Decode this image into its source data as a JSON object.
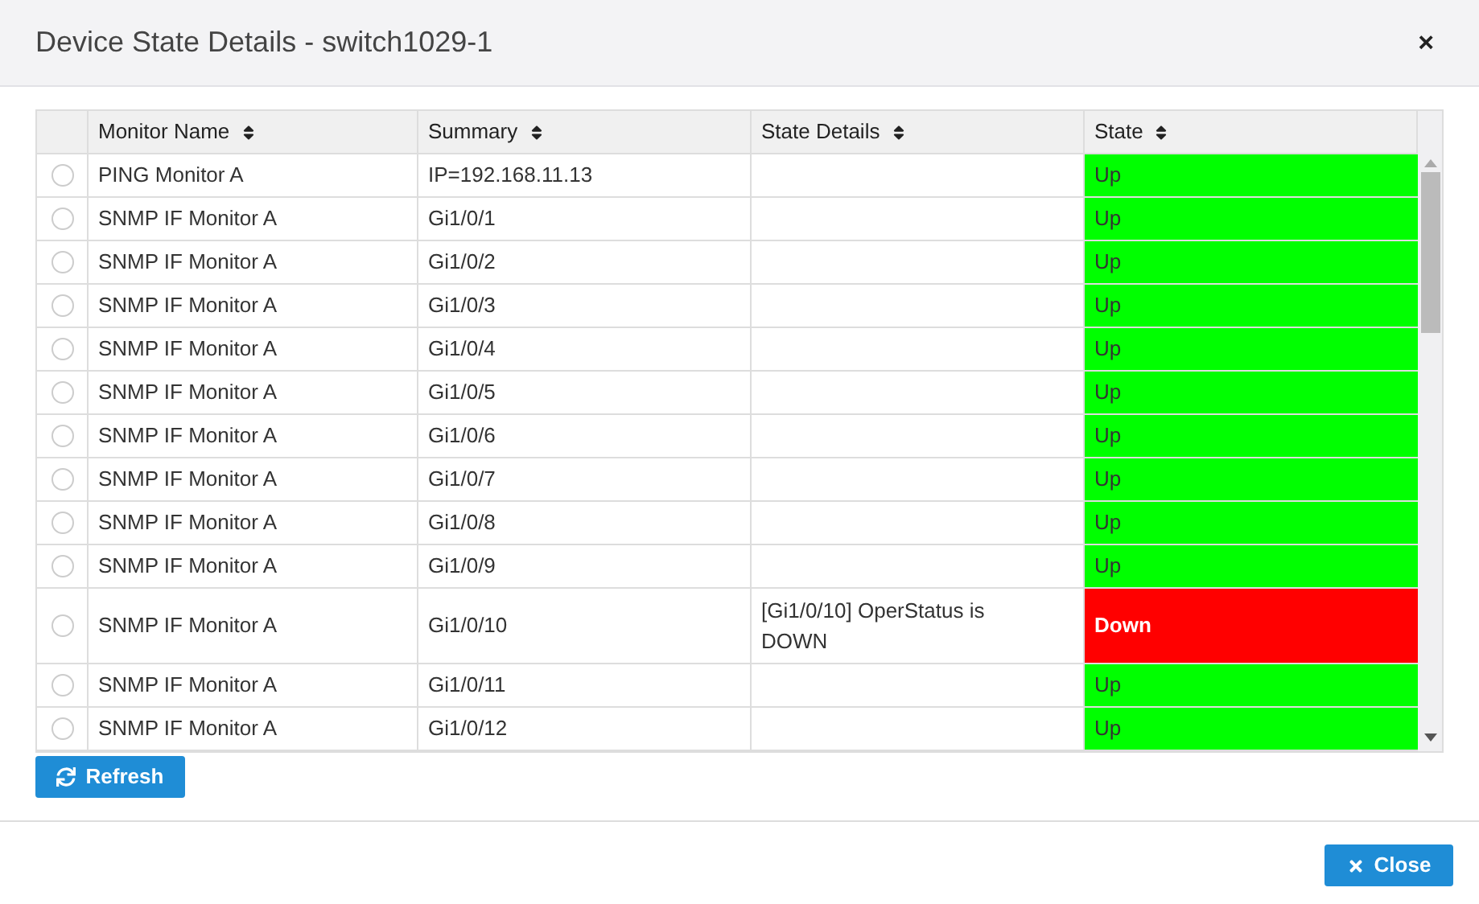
{
  "dialog": {
    "title": "Device State Details - switch1029-1",
    "close_icon": "×"
  },
  "table": {
    "columns": [
      "Monitor Name",
      "Summary",
      "State Details",
      "State"
    ],
    "rows": [
      {
        "selected": false,
        "monitor": "PING Monitor A",
        "summary": "IP=192.168.11.13",
        "details": "",
        "state": "Up",
        "kind": "up"
      },
      {
        "selected": false,
        "monitor": "SNMP IF Monitor A",
        "summary": "Gi1/0/1",
        "details": "",
        "state": "Up",
        "kind": "up"
      },
      {
        "selected": false,
        "monitor": "SNMP IF Monitor A",
        "summary": "Gi1/0/2",
        "details": "",
        "state": "Up",
        "kind": "up"
      },
      {
        "selected": false,
        "monitor": "SNMP IF Monitor A",
        "summary": "Gi1/0/3",
        "details": "",
        "state": "Up",
        "kind": "up"
      },
      {
        "selected": false,
        "monitor": "SNMP IF Monitor A",
        "summary": "Gi1/0/4",
        "details": "",
        "state": "Up",
        "kind": "up"
      },
      {
        "selected": false,
        "monitor": "SNMP IF Monitor A",
        "summary": "Gi1/0/5",
        "details": "",
        "state": "Up",
        "kind": "up"
      },
      {
        "selected": false,
        "monitor": "SNMP IF Monitor A",
        "summary": "Gi1/0/6",
        "details": "",
        "state": "Up",
        "kind": "up"
      },
      {
        "selected": false,
        "monitor": "SNMP IF Monitor A",
        "summary": "Gi1/0/7",
        "details": "",
        "state": "Up",
        "kind": "up"
      },
      {
        "selected": false,
        "monitor": "SNMP IF Monitor A",
        "summary": "Gi1/0/8",
        "details": "",
        "state": "Up",
        "kind": "up"
      },
      {
        "selected": false,
        "monitor": "SNMP IF Monitor A",
        "summary": "Gi1/0/9",
        "details": "",
        "state": "Up",
        "kind": "up"
      },
      {
        "selected": false,
        "monitor": "SNMP IF Monitor A",
        "summary": "Gi1/0/10",
        "details": "[Gi1/0/10] OperStatus is DOWN",
        "state": "Down",
        "kind": "down"
      },
      {
        "selected": false,
        "monitor": "SNMP IF Monitor A",
        "summary": "Gi1/0/11",
        "details": "",
        "state": "Up",
        "kind": "up"
      },
      {
        "selected": false,
        "monitor": "SNMP IF Monitor A",
        "summary": "Gi1/0/12",
        "details": "",
        "state": "Up",
        "kind": "up"
      }
    ]
  },
  "buttons": {
    "refresh": "Refresh",
    "close": "Close"
  }
}
